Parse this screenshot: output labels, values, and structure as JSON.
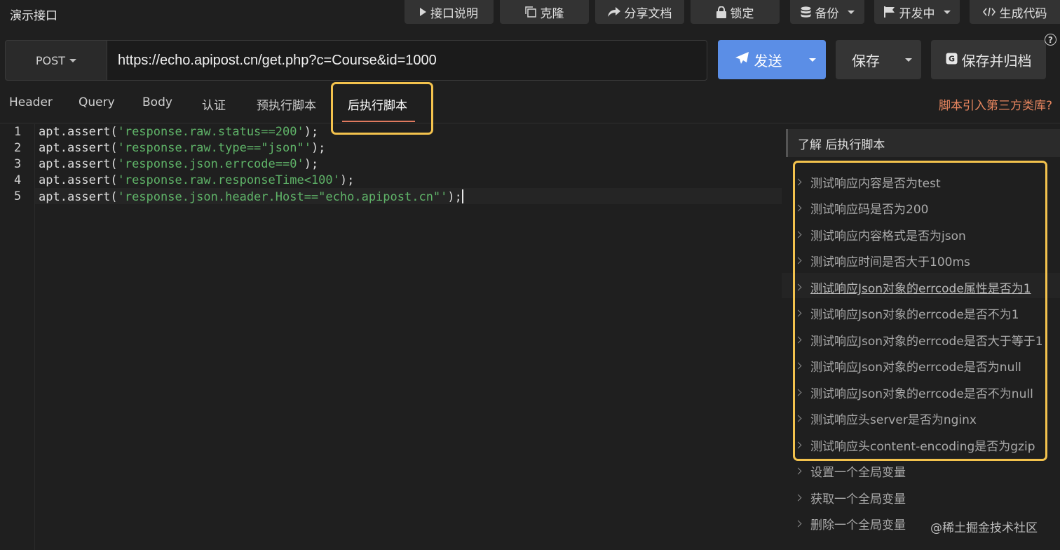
{
  "app": {
    "title": "演示接口"
  },
  "toolbar": {
    "doc": "接口说明",
    "clone": "克隆",
    "share": "分享文档",
    "lock": "锁定",
    "backup": "备份",
    "status": "开发中",
    "codegen": "生成代码"
  },
  "request": {
    "method": "POST",
    "url": "https://echo.apipost.cn/get.php?c=Course&id=1000",
    "send": "发送",
    "save": "保存",
    "save_archive": "保存并归档",
    "help": "?"
  },
  "tabs": {
    "header": "Header",
    "query": "Query",
    "body": "Body",
    "auth": "认证",
    "pre_script": "预执行脚本",
    "post_script": "后执行脚本",
    "third_party": "脚本引入第三方类库?"
  },
  "editor": {
    "lines": [
      {
        "n": "1",
        "pre": "apt.assert(",
        "str": "'response.raw.status==200'",
        "post": ");"
      },
      {
        "n": "2",
        "pre": "apt.assert(",
        "str": "'response.raw.type==\"json\"'",
        "post": ");"
      },
      {
        "n": "3",
        "pre": "apt.assert(",
        "str": "'response.json.errcode==0'",
        "post": ");"
      },
      {
        "n": "4",
        "pre": "apt.assert(",
        "str": "'response.raw.responseTime<100'",
        "post": ");"
      },
      {
        "n": "5",
        "pre": "apt.assert(",
        "str": "'response.json.header.Host==\"echo.apipost.cn\"'",
        "post": ");"
      }
    ]
  },
  "panel": {
    "title": "了解 后执行脚本",
    "snippets": [
      "测试响应内容是否为test",
      "测试响应码是否为200",
      "测试响应内容格式是否为json",
      "测试响应时间是否大于100ms",
      "测试响应Json对象的errcode属性是否为1",
      "测试响应Json对象的errcode是否不为1",
      "测试响应Json对象的errcode是否大于等于1",
      "测试响应Json对象的errcode是否为null",
      "测试响应Json对象的errcode是否不为null",
      "测试响应头server是否为nginx",
      "测试响应头content-encoding是否为gzip",
      "设置一个全局变量",
      "获取一个全局变量",
      "删除一个全局变量"
    ]
  },
  "watermark": "@稀土掘金技术社区"
}
